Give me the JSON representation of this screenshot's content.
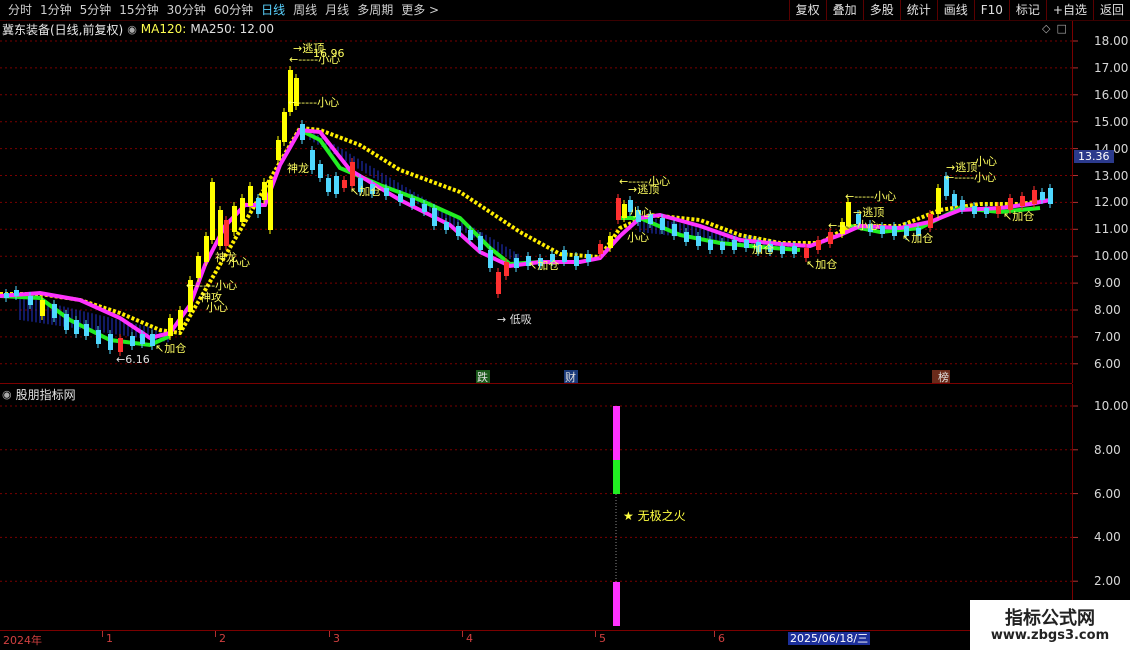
{
  "toolbar": {
    "periods": [
      "分时",
      "1分钟",
      "5分钟",
      "15分钟",
      "30分钟",
      "60分钟",
      "日线",
      "周线",
      "月线",
      "多周期",
      "更多 >"
    ],
    "active": "日线",
    "buttons": [
      "复权",
      "叠加",
      "多股",
      "统计",
      "画线",
      "F10",
      "标记",
      "+自选",
      "返回"
    ]
  },
  "chart_header": {
    "stock": "冀东装备(日线,前复权)",
    "icon": "circle-chevron-icon",
    "ma120": "MA120:",
    "ma250": "MA250: 12.00"
  },
  "price_axis": {
    "ticks": [
      "18.00",
      "17.00",
      "16.00",
      "15.00",
      "14.00",
      "13.00",
      "12.00",
      "11.00",
      "10.00",
      "9.00",
      "8.00",
      "7.00",
      "6.00"
    ],
    "current_price": "13.36"
  },
  "indicator": {
    "title": "股朋指标网",
    "ticks": [
      "10.00",
      "8.00",
      "6.00",
      "4.00",
      "2.00"
    ],
    "signal_label": "★ 无极之火"
  },
  "annotations": {
    "low_price": "←6.16",
    "add": "↖加仓",
    "add2": "加仓",
    "escape": "→逃顶",
    "escape2": "逃顶",
    "careful": "小心",
    "careful_dash": "←-----小心",
    "low_buy": "→ 低吸",
    "dragon": "神龙",
    "attack": "神攻",
    "high_label": "16.96",
    "event_die": "跌",
    "event_cai": "财",
    "event_bang": "榜"
  },
  "date_axis": {
    "labels": [
      "2024年",
      "1",
      "2",
      "3",
      "4",
      "5",
      "6",
      "2025/06/18/三"
    ]
  },
  "watermark": {
    "line1": "指标公式网",
    "line2": "www.zbgs3.com"
  },
  "colors": {
    "up": "#ffff00",
    "down_cyan": "#4fd8ff",
    "up_red": "#ff3030",
    "ma_pink": "#ff33ff",
    "ma_green": "#22ee22",
    "ma_yellow": "#ffee00",
    "fill_blue": "#2233cc",
    "grid": "#7a0000"
  }
}
